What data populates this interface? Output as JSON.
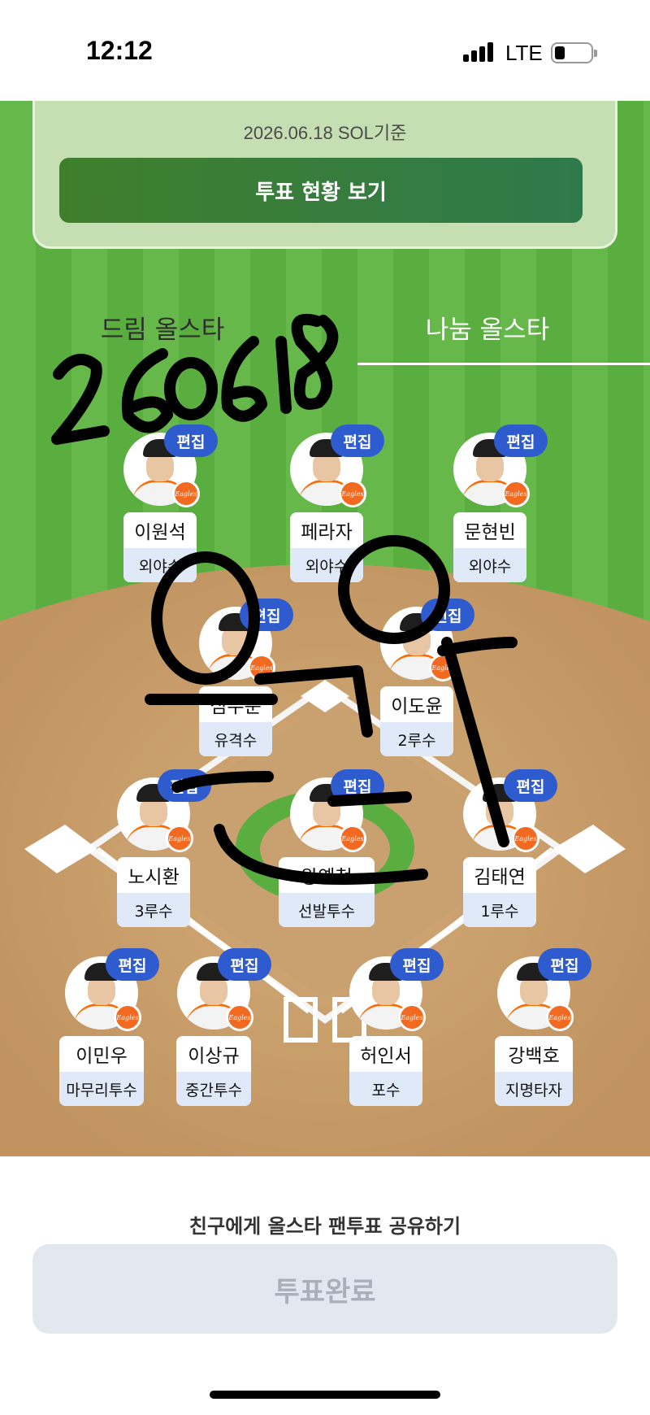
{
  "status_bar": {
    "time": "12:12",
    "network": "LTE",
    "icons": [
      "signal-icon",
      "battery-icon"
    ]
  },
  "vote_card": {
    "date_text": "2026.06.18 SOL기준",
    "view_button_label": "투표 현황 보기"
  },
  "tabs": [
    {
      "label": "드림 올스타",
      "selected": false
    },
    {
      "label": "나눔 올스타",
      "selected": true
    }
  ],
  "edit_label": "편집",
  "team_logo_text": "Eagles",
  "players": [
    {
      "name": "이원석",
      "position": "외야수"
    },
    {
      "name": "페라자",
      "position": "외야수"
    },
    {
      "name": "문현빈",
      "position": "외야수"
    },
    {
      "name": "심우준",
      "position": "유격수"
    },
    {
      "name": "이도윤",
      "position": "2루수"
    },
    {
      "name": "노시환",
      "position": "3루수"
    },
    {
      "name": "왕옌청",
      "position": "선발투수"
    },
    {
      "name": "김태연",
      "position": "1루수"
    },
    {
      "name": "이민우",
      "position": "마무리투수"
    },
    {
      "name": "이상규",
      "position": "중간투수"
    },
    {
      "name": "허인서",
      "position": "포수"
    },
    {
      "name": "강백호",
      "position": "지명타자"
    }
  ],
  "share_text": "친구에게 올스타 팬투표 공유하기",
  "done_button_label": "투표완료",
  "handwriting": {
    "numbers": "260618",
    "text": "오오 목"
  },
  "colors": {
    "edit_badge": "#2e5ccf",
    "vote_button": "#3f7f2c",
    "position_bg": "#dfe9f7",
    "grass": "#66b84a",
    "dirt": "#c9a06f"
  }
}
